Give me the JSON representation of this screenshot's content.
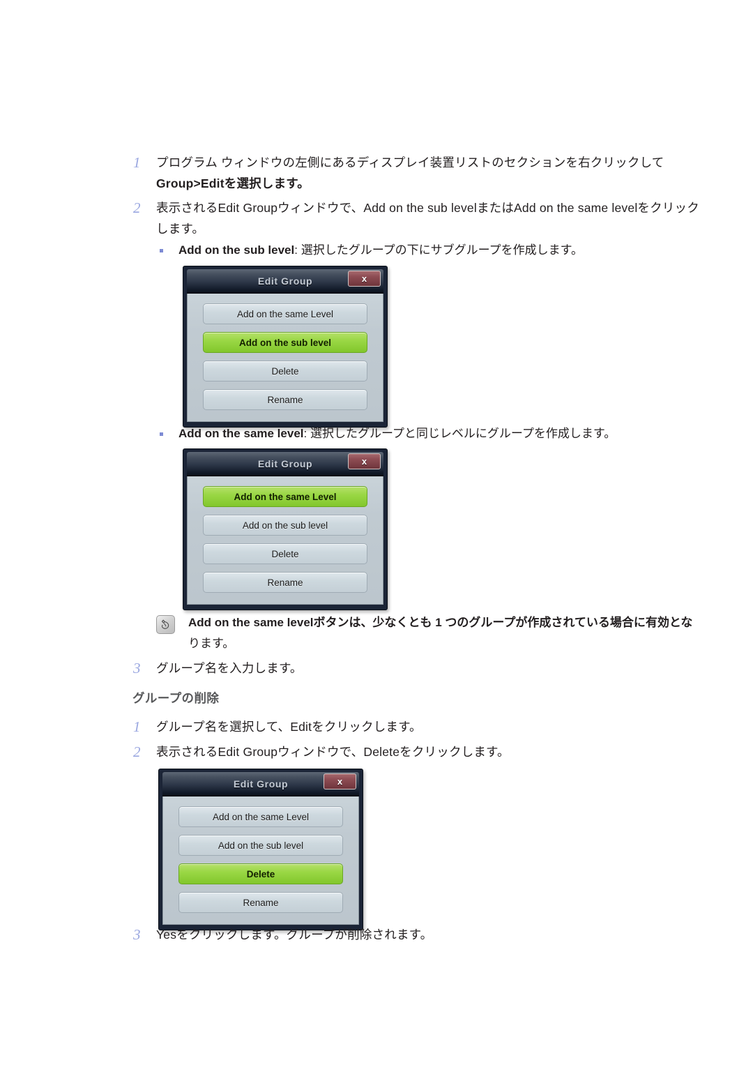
{
  "steps_create": [
    {
      "num": "1",
      "lines": [
        "プログラム ウィンドウの左側にあるディスプレイ装置リストのセクションを右クリックして",
        "Group>Editを選択します。"
      ]
    },
    {
      "num": "2",
      "lines": [
        "表示されるEdit Groupウィンドウで、Add on the sub levelまたはAdd on the same levelをクリック",
        "します。"
      ]
    }
  ],
  "bullets": [
    {
      "term": "Add on the sub level",
      "rest": ": 選択したグループの下にサブグループを作成します。"
    },
    {
      "term": "Add on the same level",
      "rest": ": 選択したグループと同じレベルにグループを作成します。"
    }
  ],
  "note": {
    "icon": "note-pencil-icon",
    "lines": [
      "Add on the same levelボタンは、少なくとも 1 つのグループが作成されている場合に有効とな",
      "ります。"
    ]
  },
  "step3_create": {
    "num": "3",
    "text": "グループ名を入力します。"
  },
  "heading_delete": "グループの削除",
  "steps_delete": [
    {
      "num": "1",
      "text": "グループ名を選択して、Editをクリックします。"
    },
    {
      "num": "2",
      "text": "表示されるEdit Groupウィンドウで、Deleteをクリックします。"
    }
  ],
  "step3_delete": {
    "num": "3",
    "text": "Yesをクリックします。グループが削除されます。"
  },
  "dialogs": [
    {
      "title": "Edit Group",
      "close_label": "x",
      "buttons": [
        {
          "label": "Add on the same Level",
          "selected": false
        },
        {
          "label": "Add on the sub level",
          "selected": true
        },
        {
          "label": "Delete",
          "selected": false
        },
        {
          "label": "Rename",
          "selected": false
        }
      ]
    },
    {
      "title": "Edit Group",
      "close_label": "x",
      "buttons": [
        {
          "label": "Add on the same Level",
          "selected": true
        },
        {
          "label": "Add on the sub level",
          "selected": false
        },
        {
          "label": "Delete",
          "selected": false
        },
        {
          "label": "Rename",
          "selected": false
        }
      ]
    },
    {
      "title": "Edit Group",
      "close_label": "x",
      "buttons": [
        {
          "label": "Add on the same Level",
          "selected": false
        },
        {
          "label": "Add on the sub level",
          "selected": false
        },
        {
          "label": "Delete",
          "selected": true
        },
        {
          "label": "Rename",
          "selected": false
        }
      ]
    }
  ],
  "colors": {
    "step_number": "#9aa7e0",
    "bullet_dot": "#7d8bd4",
    "heading": "#58595b",
    "dialog_frame": "#1b2436",
    "dialog_body": "#c2ccd2",
    "button_face": "#cdd8de",
    "button_selected": "#9ad745",
    "close_button": "#8e4d54"
  }
}
